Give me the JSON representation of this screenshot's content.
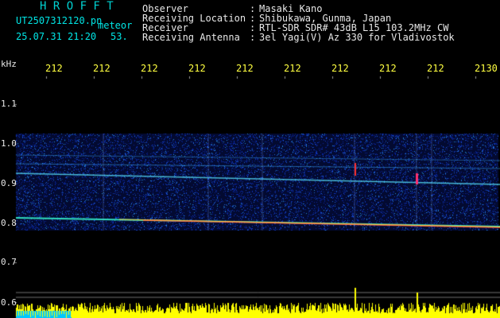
{
  "logo": "H R O F F T",
  "file_name": "UT2507312120.pn",
  "file_type": "meteor",
  "date_time": "25.07.31 21:20",
  "count": "53.",
  "info": [
    {
      "label": "Observer",
      "sep": ":",
      "value": "Masaki Kano"
    },
    {
      "label": "Receiving Location",
      "sep": ":",
      "value": "Shibukawa, Gunma, Japan"
    },
    {
      "label": "Receiver",
      "sep": ":",
      "value": "RTL-SDR SDR# 43dB L15 103.2MHz CW"
    },
    {
      "label": "Receiving Antenna",
      "sep": ":",
      "value": "3el Yagi(V) Az 330 for Vladivostok"
    }
  ],
  "y_unit": "kHz",
  "y_ticks": [
    "1.1",
    "1.0",
    "0.9",
    "0.8",
    "0.7",
    "0.6"
  ],
  "x_ticks": [
    "212",
    "212",
    "212",
    "212",
    "212",
    "212",
    "212",
    "212",
    "212",
    "2130"
  ],
  "colors": {
    "logo": "#00d2d2",
    "ticks": "#ffff40",
    "trace": "#ffff00",
    "background": "#000000"
  }
}
